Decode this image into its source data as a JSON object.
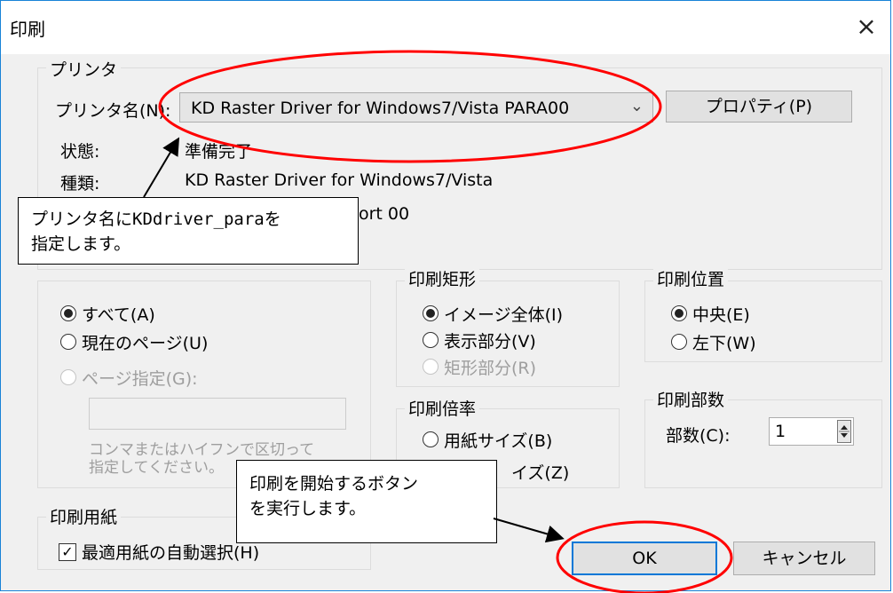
{
  "window": {
    "title": "印刷",
    "close_glyph": "×"
  },
  "printer": {
    "group_label": "プリンタ",
    "name_label": "プリンタ名(N):",
    "name_value": "KD Raster Driver for Windows7/Vista PARA00",
    "properties_button": "プロパティ(P)",
    "status_label": "状態:",
    "status_value": "準備完了",
    "type_label": "種類:",
    "type_value": "KD Raster Driver for Windows7/Vista",
    "location_partial": "ort 00"
  },
  "print_range": {
    "options": [
      {
        "label": "すべて(A)",
        "checked": true,
        "enabled": true
      },
      {
        "label": "現在のページ(U)",
        "checked": false,
        "enabled": true
      },
      {
        "label": "ページ指定(G):",
        "checked": false,
        "enabled": false
      }
    ],
    "hint_line1": "コンマまたはハイフンで区切って",
    "hint_line2": "指定してください。"
  },
  "print_rect": {
    "group_label": "印刷矩形",
    "options": [
      {
        "label": "イメージ全体(I)",
        "checked": true,
        "enabled": true
      },
      {
        "label": "表示部分(V)",
        "checked": false,
        "enabled": true
      },
      {
        "label": "矩形部分(R)",
        "checked": false,
        "enabled": false
      }
    ]
  },
  "print_position": {
    "group_label": "印刷位置",
    "options": [
      {
        "label": "中央(E)",
        "checked": true
      },
      {
        "label": "左下(W)",
        "checked": false
      }
    ]
  },
  "print_scale": {
    "group_label": "印刷倍率",
    "option1": "用紙サイズ(B)",
    "option2_partial": "イズ(Z)"
  },
  "copies": {
    "group_label": "印刷部数",
    "label": "部数(C):",
    "value": "1"
  },
  "paper": {
    "group_label": "印刷用紙",
    "auto_select_label": "最適用紙の自動選択(H)",
    "auto_select_checked": true
  },
  "buttons": {
    "ok": "OK",
    "cancel": "キャンセル"
  },
  "callouts": {
    "printer_note_line1": "プリンタ名にKDdriver_paraを",
    "printer_note_line2": "指定します。",
    "ok_note_line1": "印刷を開始するボタン",
    "ok_note_line2": "を実行します。"
  },
  "colors": {
    "highlight": "#ff0000",
    "focus_blue": "#0078d7"
  }
}
